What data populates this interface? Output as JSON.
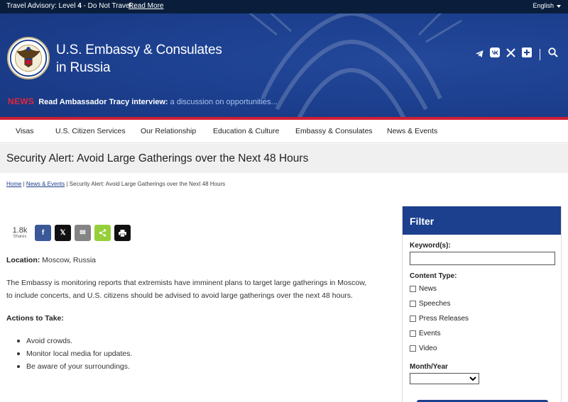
{
  "advisory": {
    "text_prefix": "Travel Advisory: Level ",
    "level": "4",
    "text_suffix": " - Do Not Travel...",
    "read_more": "Read More",
    "language": "English"
  },
  "header": {
    "title_line1": "U.S. Embassy & Consulates",
    "title_line2": "in Russia",
    "news_label": "NEWS",
    "news_headline": "Read Ambassador Tracy interview:",
    "news_sub": " a discussion on opportunities...",
    "social_icons": [
      "telegram-icon",
      "vk-icon",
      "x-icon",
      "plus-icon",
      "search-icon"
    ]
  },
  "nav": {
    "items": [
      "Visas",
      "U.S. Citizen Services",
      "Our Relationship",
      "Education & Culture",
      "Embassy & Consulates",
      "News & Events"
    ]
  },
  "page": {
    "title": "Security Alert: Avoid Large Gatherings over the Next 48 Hours"
  },
  "breadcrumb": {
    "home": "Home",
    "sep1": " | ",
    "section": "News & Events",
    "sep2": " | ",
    "current": "Security Alert: Avoid Large Gatherings over the Next 48 Hours"
  },
  "share": {
    "count": "1.8k",
    "count_label": "Shares",
    "buttons": [
      {
        "name": "facebook",
        "glyph": "f",
        "color": "#3b5998"
      },
      {
        "name": "twitter",
        "glyph": "𝕏",
        "color": "#111111"
      },
      {
        "name": "email",
        "glyph": "✉",
        "color": "#848484"
      },
      {
        "name": "sharethis",
        "glyph": "⋖",
        "color": "#95d03a"
      },
      {
        "name": "print",
        "glyph": "⎙",
        "color": "#111111"
      }
    ]
  },
  "content": {
    "location_label": "Location:",
    "location_value": " Moscow, Russia",
    "paragraph": "The Embassy is monitoring reports that extremists have imminent plans to target large gatherings in Moscow, to include concerts, and U.S. citizens should be advised to avoid large gatherings over the next 48 hours.",
    "actions_heading": "Actions to Take:",
    "actions": [
      "Avoid crowds.",
      "Monitor local media for updates.",
      "Be aware of your surroundings."
    ]
  },
  "filter": {
    "heading": "Filter",
    "keyword_label": "Keyword(s):",
    "keyword_value": "",
    "content_type_label": "Content Type:",
    "content_types": [
      "News",
      "Speeches",
      "Press Releases",
      "Events",
      "Video"
    ],
    "month_year_label": "Month/Year",
    "month_year_value": ""
  },
  "colors": {
    "navy": "#0a1e3c",
    "brand_blue": "#1c3f8e",
    "accent_red": "#d01f34"
  }
}
